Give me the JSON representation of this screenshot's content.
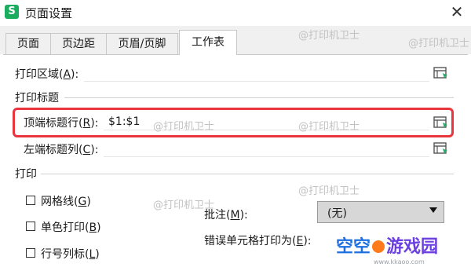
{
  "window": {
    "icon_letter": "S",
    "title": "页面设置",
    "close_glyph": "✕"
  },
  "tabs": [
    {
      "label": "页面",
      "active": false
    },
    {
      "label": "页边距",
      "active": false
    },
    {
      "label": "页眉/页脚",
      "active": false
    },
    {
      "label": "工作表",
      "active": true
    }
  ],
  "print_area": {
    "label": "打印区域(",
    "key": "A",
    "label_end": "):",
    "value": ""
  },
  "print_titles": {
    "section": "打印标题",
    "top_rows": {
      "label": "顶端标题行(",
      "key": "R",
      "label_end": "):",
      "value": "$1:$1"
    },
    "left_cols": {
      "label": "左端标题列(",
      "key": "C",
      "label_end": "):",
      "value": ""
    }
  },
  "print": {
    "section": "打印",
    "options": [
      {
        "label": "网格线(",
        "key": "G",
        "label_end": ")",
        "checked": false
      },
      {
        "label": "单色打印(",
        "key": "B",
        "label_end": ")",
        "checked": false
      },
      {
        "label": "行号列标(",
        "key": "L",
        "label_end": ")",
        "checked": false
      }
    ],
    "comments": {
      "label": "批注(",
      "key": "M",
      "label_end": "):",
      "value": "(无)"
    },
    "errors_as": {
      "label": "错误单元格打印为(",
      "key": "E",
      "label_end": "):"
    }
  },
  "watermark": "@打印机卫士",
  "brand": {
    "part1": "空空",
    "part2": "游戏园",
    "url": "www.kkaoo.com"
  },
  "colors": {
    "accent_red": "#e8363c",
    "app_green": "#1aad5f",
    "brand_blue": "#1e6fe0",
    "brand_orange": "#ff7a1a"
  }
}
